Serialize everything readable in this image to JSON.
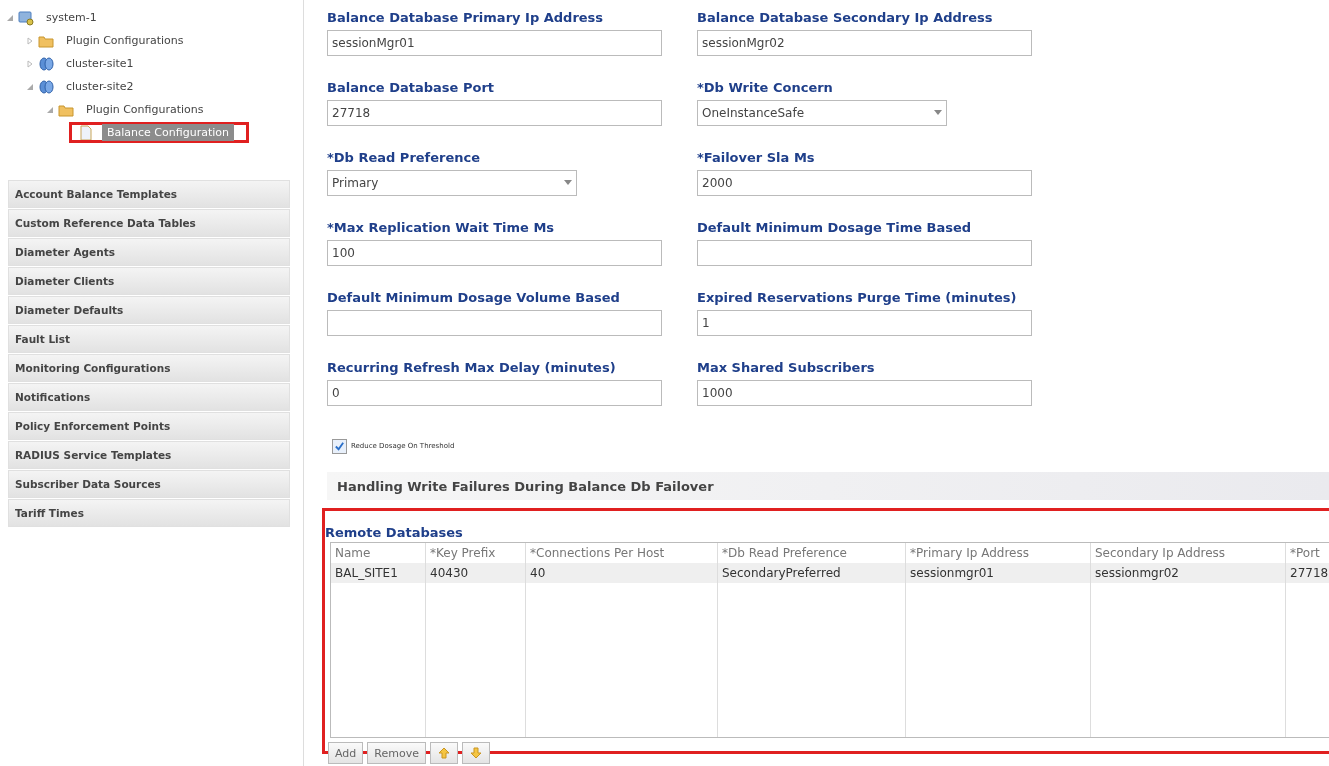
{
  "tree": [
    {
      "label": "system-1",
      "kind": "system",
      "expanded": true,
      "selected": false,
      "children": [
        {
          "label": "Plugin Configurations",
          "kind": "folder",
          "expanded": false,
          "selected": false
        },
        {
          "label": "cluster-site1",
          "kind": "cluster",
          "expanded": false,
          "selected": false
        },
        {
          "label": "cluster-site2",
          "kind": "cluster",
          "expanded": true,
          "selected": false,
          "children": [
            {
              "label": "Plugin Configurations",
              "kind": "folder",
              "expanded": true,
              "selected": false,
              "children": [
                {
                  "label": "Balance Configuration",
                  "kind": "file",
                  "selected": true,
                  "highlighted": true
                }
              ]
            }
          ]
        }
      ]
    }
  ],
  "menu": [
    "Account Balance Templates",
    "Custom Reference Data Tables",
    "Diameter Agents",
    "Diameter Clients",
    "Diameter Defaults",
    "Fault List",
    "Monitoring Configurations",
    "Notifications",
    "Policy Enforcement Points",
    "RADIUS Service Templates",
    "Subscriber Data Sources",
    "Tariff Times"
  ],
  "fields": [
    [
      {
        "label": "Balance Database Primary Ip Address",
        "kind": "text",
        "value": "sessionMgr01"
      },
      {
        "label": "Balance Database Secondary Ip Address",
        "kind": "text",
        "value": "sessionMgr02"
      }
    ],
    [
      {
        "label": "Balance Database Port",
        "kind": "text",
        "value": "27718"
      },
      {
        "label": "*Db Write Concern",
        "kind": "select",
        "value": "OneInstanceSafe"
      }
    ],
    [
      {
        "label": "*Db Read Preference",
        "kind": "select",
        "value": "Primary"
      },
      {
        "label": "*Failover Sla Ms",
        "kind": "text",
        "value": "2000"
      }
    ],
    [
      {
        "label": "*Max Replication Wait Time Ms",
        "kind": "text",
        "value": "100"
      },
      {
        "label": "Default Minimum Dosage Time Based",
        "kind": "text"
      }
    ],
    [
      {
        "label": "Default Minimum Dosage Volume Based",
        "kind": "text"
      },
      {
        "label": "Expired Reservations Purge Time (minutes)",
        "kind": "text",
        "value": "1"
      }
    ],
    [
      {
        "label": "Recurring Refresh Max Delay (minutes)",
        "kind": "text",
        "value": "0"
      },
      {
        "label": "Max Shared Subscribers",
        "kind": "text",
        "value": "1000"
      }
    ]
  ],
  "checkbox": {
    "label": "Reduce Dosage On Threshold",
    "checked": true
  },
  "section_header": "Handling Write Failures During Balance Db Failover",
  "remote": {
    "title": "Remote Databases",
    "highlighted": true,
    "columns": [
      "Name",
      "*Key Prefix",
      "*Connections Per Host",
      "*Db Read Preference",
      "*Primary Ip Address",
      "Secondary Ip Address",
      "*Port"
    ],
    "rows": [
      [
        "BAL_SITE1",
        "40430",
        "40",
        "SecondaryPreferred",
        "sessionmgr01",
        "sessionmgr02",
        "27718"
      ]
    ],
    "buttons": [
      {
        "kind": "text",
        "label": "Add"
      },
      {
        "kind": "text",
        "label": "Remove"
      },
      {
        "kind": "up"
      },
      {
        "kind": "down"
      }
    ]
  }
}
